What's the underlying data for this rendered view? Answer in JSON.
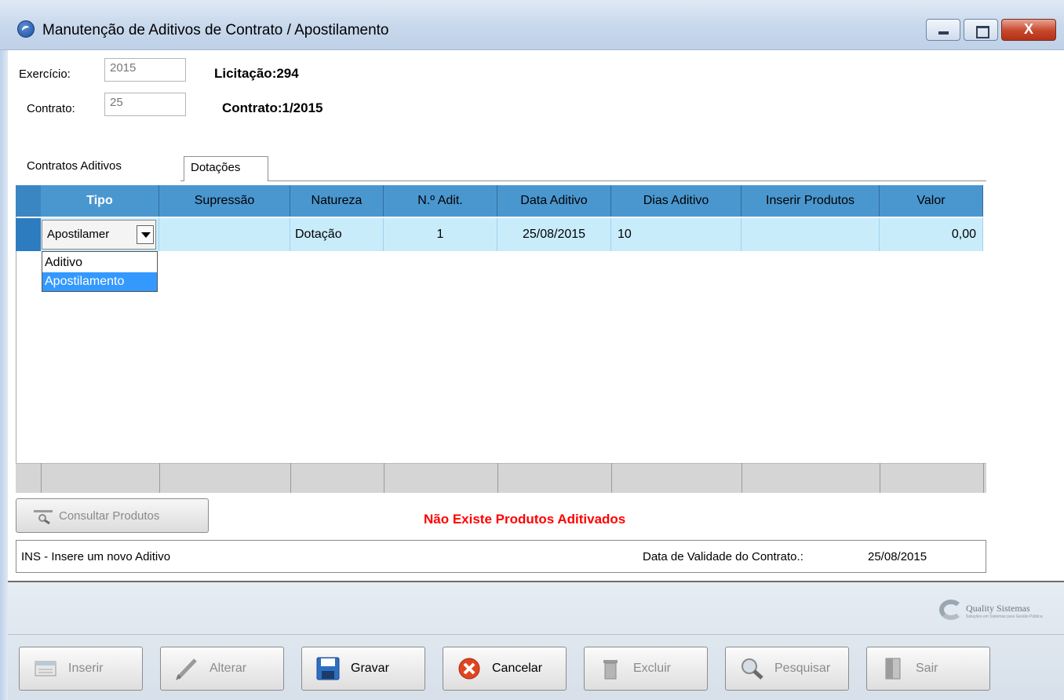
{
  "window": {
    "title": "Manutenção de Aditivos de Contrato / Apostilamento",
    "close_glyph": "X"
  },
  "header": {
    "exercicio_label": "Exercício:",
    "exercicio_value": "2015",
    "contrato_label": "Contrato:",
    "contrato_value": "25",
    "licitacao": "Licitação:294",
    "contrato_info": "Contrato:1/2015"
  },
  "tabs": [
    {
      "label": "Contratos Aditivos",
      "active": true
    },
    {
      "label": "Dotações",
      "active": false
    }
  ],
  "grid": {
    "columns": [
      "Tipo",
      "Supressão",
      "Natureza",
      "N.º Adit.",
      "Data Aditivo",
      "Dias Aditivo",
      "Inserir Produtos",
      "Valor"
    ],
    "rows": [
      {
        "tipo": "Apostilamer",
        "supressao": "",
        "natureza": "Dotação",
        "num_adit": "1",
        "data_aditivo": "25/08/2015",
        "dias_aditivo": "10",
        "inserir_produtos": "",
        "valor": "0,00"
      }
    ],
    "tipo_options": [
      "Aditivo",
      "Apostilamento"
    ],
    "tipo_selected_option": "Apostilamento"
  },
  "consultar_button": "Consultar Produtos",
  "warning": "Não Existe Produtos Aditivados",
  "status": {
    "hint": "INS - Insere um novo Aditivo",
    "validade_label": "Data de Validade do Contrato.:",
    "validade_value": "25/08/2015"
  },
  "logo": {
    "name": "Quality Sistemas",
    "tagline": "Soluções em Sistemas para Gestão Pública"
  },
  "toolbar": [
    {
      "label": "Inserir",
      "icon": "insert-icon",
      "enabled": false
    },
    {
      "label": "Alterar",
      "icon": "pencil-icon",
      "enabled": false
    },
    {
      "label": "Gravar",
      "icon": "floppy-disk-icon",
      "enabled": true
    },
    {
      "label": "Cancelar",
      "icon": "cancel-icon",
      "enabled": true
    },
    {
      "label": "Excluir",
      "icon": "trash-icon",
      "enabled": false
    },
    {
      "label": "Pesquisar",
      "icon": "magnifier-icon",
      "enabled": false
    },
    {
      "label": "Sair",
      "icon": "exit-door-icon",
      "enabled": false
    }
  ],
  "colors": {
    "grid_header": "#4a97cf",
    "grid_row": "#c9ecfb",
    "dropdown_selected": "#3399ff",
    "warning_text": "#ff0000",
    "cancel_icon": "#e2441f"
  }
}
